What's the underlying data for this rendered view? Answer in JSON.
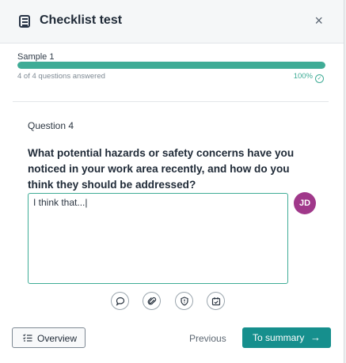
{
  "header": {
    "title": "Checklist test",
    "close_symbol": "×",
    "icon": "checklist-icon"
  },
  "progress": {
    "sample_label": "Sample 1",
    "answered_text": "4 of 4 questions answered",
    "percent_text": "100%",
    "fraction": 1.0,
    "color": "#3fac96"
  },
  "question": {
    "number_label": "Question 4",
    "text": "What potential hazards or safety concerns have you noticed in your work area recently, and how do you think they should be addressed?"
  },
  "answer": {
    "value": "I think that...|"
  },
  "avatar": {
    "initials": "JD",
    "color": "#a0388a"
  },
  "tools": [
    "comment-icon",
    "paperclip-icon",
    "shield-icon",
    "calendar-check-icon"
  ],
  "footer": {
    "overview_label": "Overview",
    "previous_label": "Previous",
    "summary_label": "To summary",
    "summary_arrow": "→",
    "accent": "#168f8d"
  }
}
